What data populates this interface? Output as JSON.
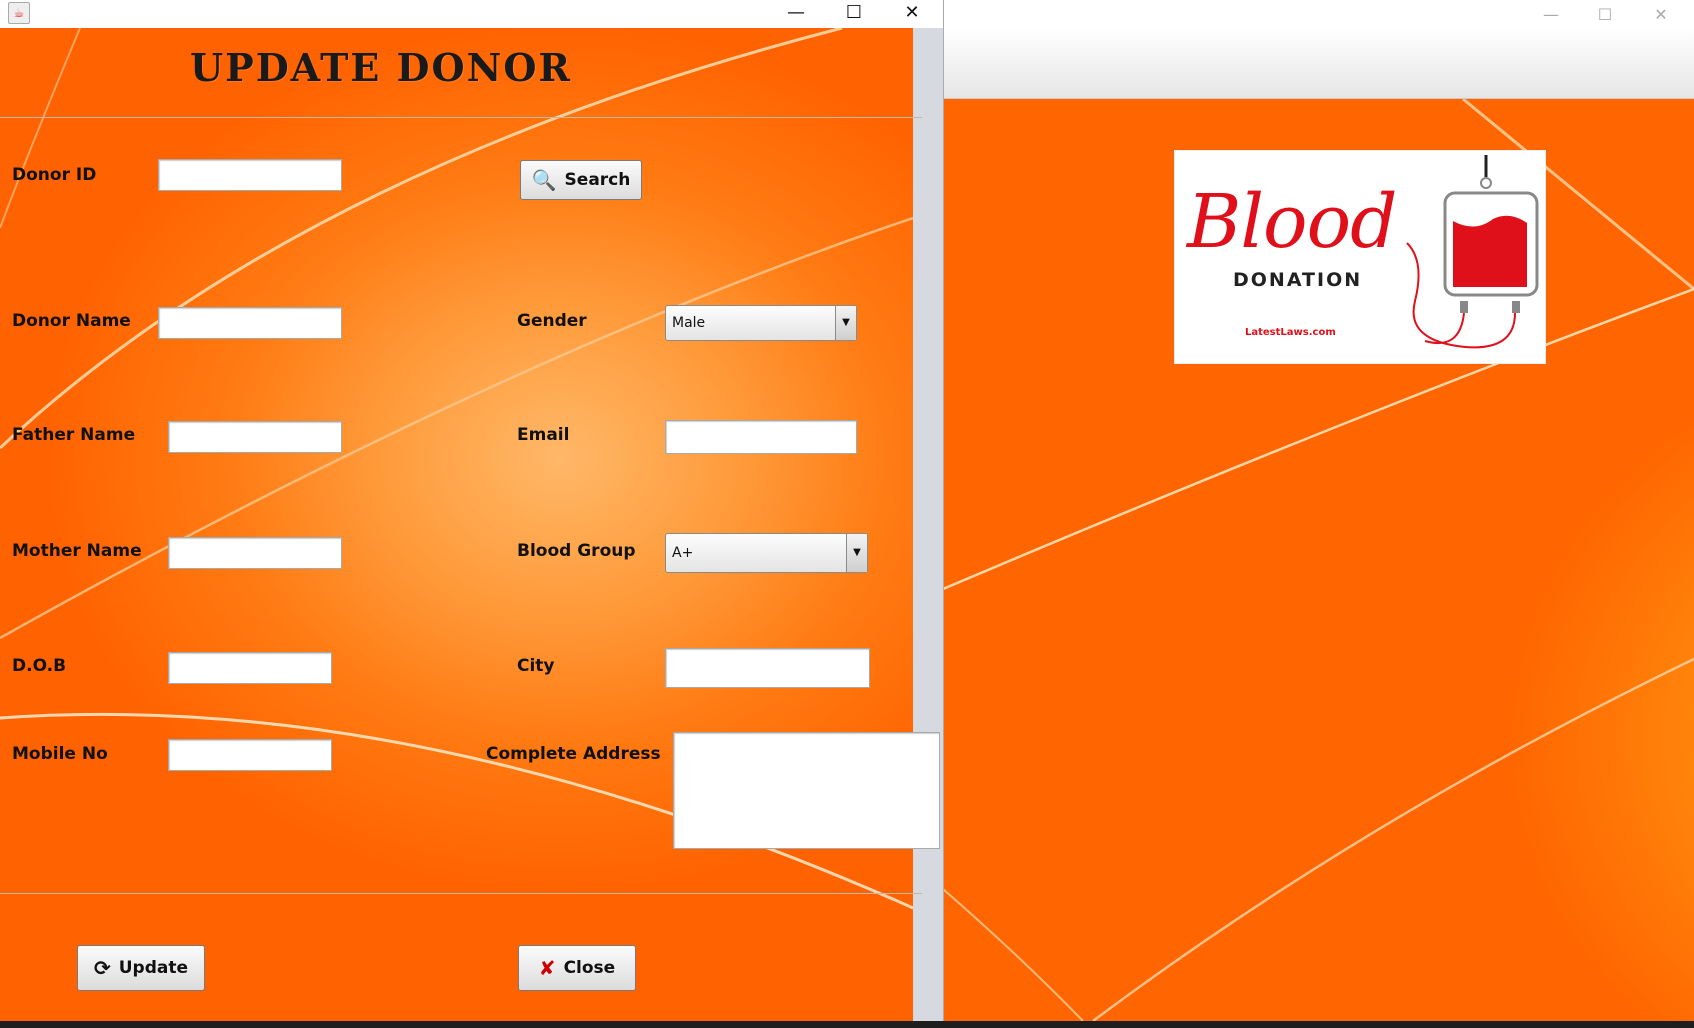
{
  "background_window": {
    "controls": {
      "minimize": "—",
      "maximize": "☐",
      "close": "✕"
    },
    "logo": {
      "title_text": "Blood",
      "subtitle_text": "DONATION",
      "site_text": "LatestLaws.com"
    }
  },
  "dialog": {
    "controls": {
      "minimize": "—",
      "maximize": "☐",
      "close": "✕"
    },
    "heading": "UPDATE DONOR",
    "fields": {
      "donor_id": {
        "label": "Donor ID",
        "value": ""
      },
      "donor_name": {
        "label": "Donor Name",
        "value": ""
      },
      "father_name": {
        "label": "Father Name",
        "value": ""
      },
      "mother_name": {
        "label": "Mother Name",
        "value": ""
      },
      "dob": {
        "label": "D.O.B",
        "value": ""
      },
      "mobile_no": {
        "label": "Mobile No",
        "value": ""
      },
      "gender": {
        "label": "Gender",
        "selected": "Male"
      },
      "email": {
        "label": "Email",
        "value": ""
      },
      "blood_group": {
        "label": "Blood Group",
        "selected": "A+"
      },
      "city": {
        "label": "City",
        "value": ""
      },
      "complete_address": {
        "label": "Complete Address",
        "value": ""
      }
    },
    "buttons": {
      "search": "Search",
      "update": "Update",
      "close": "Close"
    }
  },
  "colors": {
    "background_orange": "#ff7a12",
    "logo_red": "#e0101a"
  },
  "icons": {
    "search_button": "magnifier-icon",
    "update_button": "refresh-icon",
    "close_button": "x-icon",
    "app": "java-icon"
  }
}
